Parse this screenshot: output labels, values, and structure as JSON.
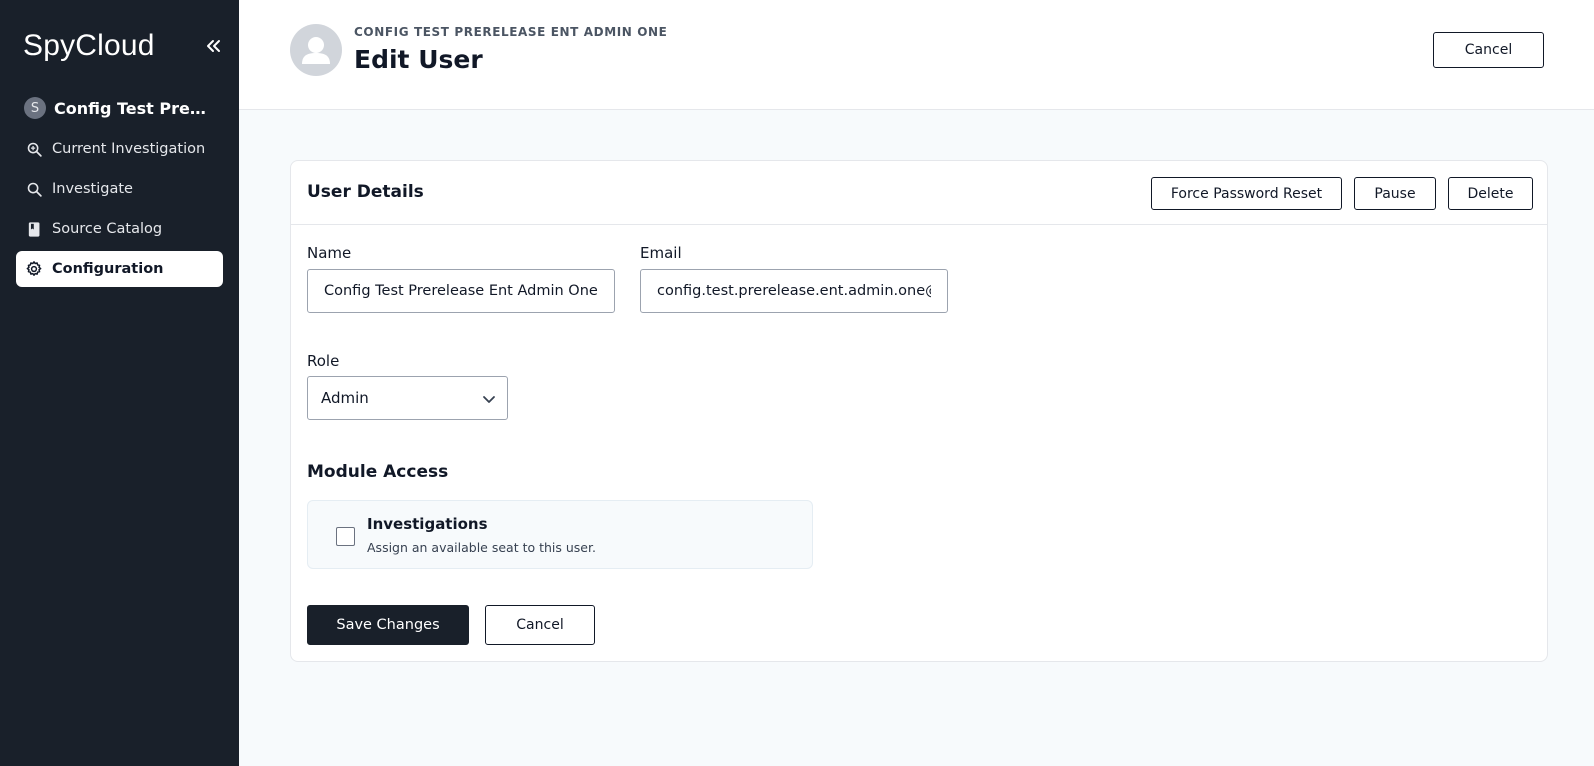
{
  "app": {
    "logo_text": "SpyCloud"
  },
  "sidebar": {
    "org": {
      "avatar_letter": "S",
      "name": "Config Test PreRelease Ent"
    },
    "items": [
      {
        "label": "Current Investigation",
        "icon": "search-magnifier-plus-icon"
      },
      {
        "label": "Investigate",
        "icon": "search-icon"
      },
      {
        "label": "Source Catalog",
        "icon": "book-icon"
      },
      {
        "label": "Configuration",
        "icon": "gear-icon",
        "active": true
      }
    ]
  },
  "header": {
    "subtitle": "CONFIG TEST PRERELEASE ENT ADMIN ONE",
    "title": "Edit User",
    "cancel_label": "Cancel"
  },
  "card": {
    "title": "User Details",
    "force_reset_label": "Force Password Reset",
    "pause_label": "Pause",
    "delete_label": "Delete",
    "name_label": "Name",
    "name_value": "Config Test Prerelease Ent Admin One",
    "email_label": "Email",
    "email_value": "config.test.prerelease.ent.admin.one@",
    "role_label": "Role",
    "role_value": "Admin",
    "module_section_title": "Module Access",
    "module": {
      "title": "Investigations",
      "description": "Assign an available seat to this user.",
      "checked": false
    },
    "save_label": "Save Changes",
    "cancel_label": "Cancel"
  },
  "colors": {
    "sidebar_bg": "#19202a",
    "page_bg": "#f7fafc",
    "primary_button": "#19202a"
  }
}
